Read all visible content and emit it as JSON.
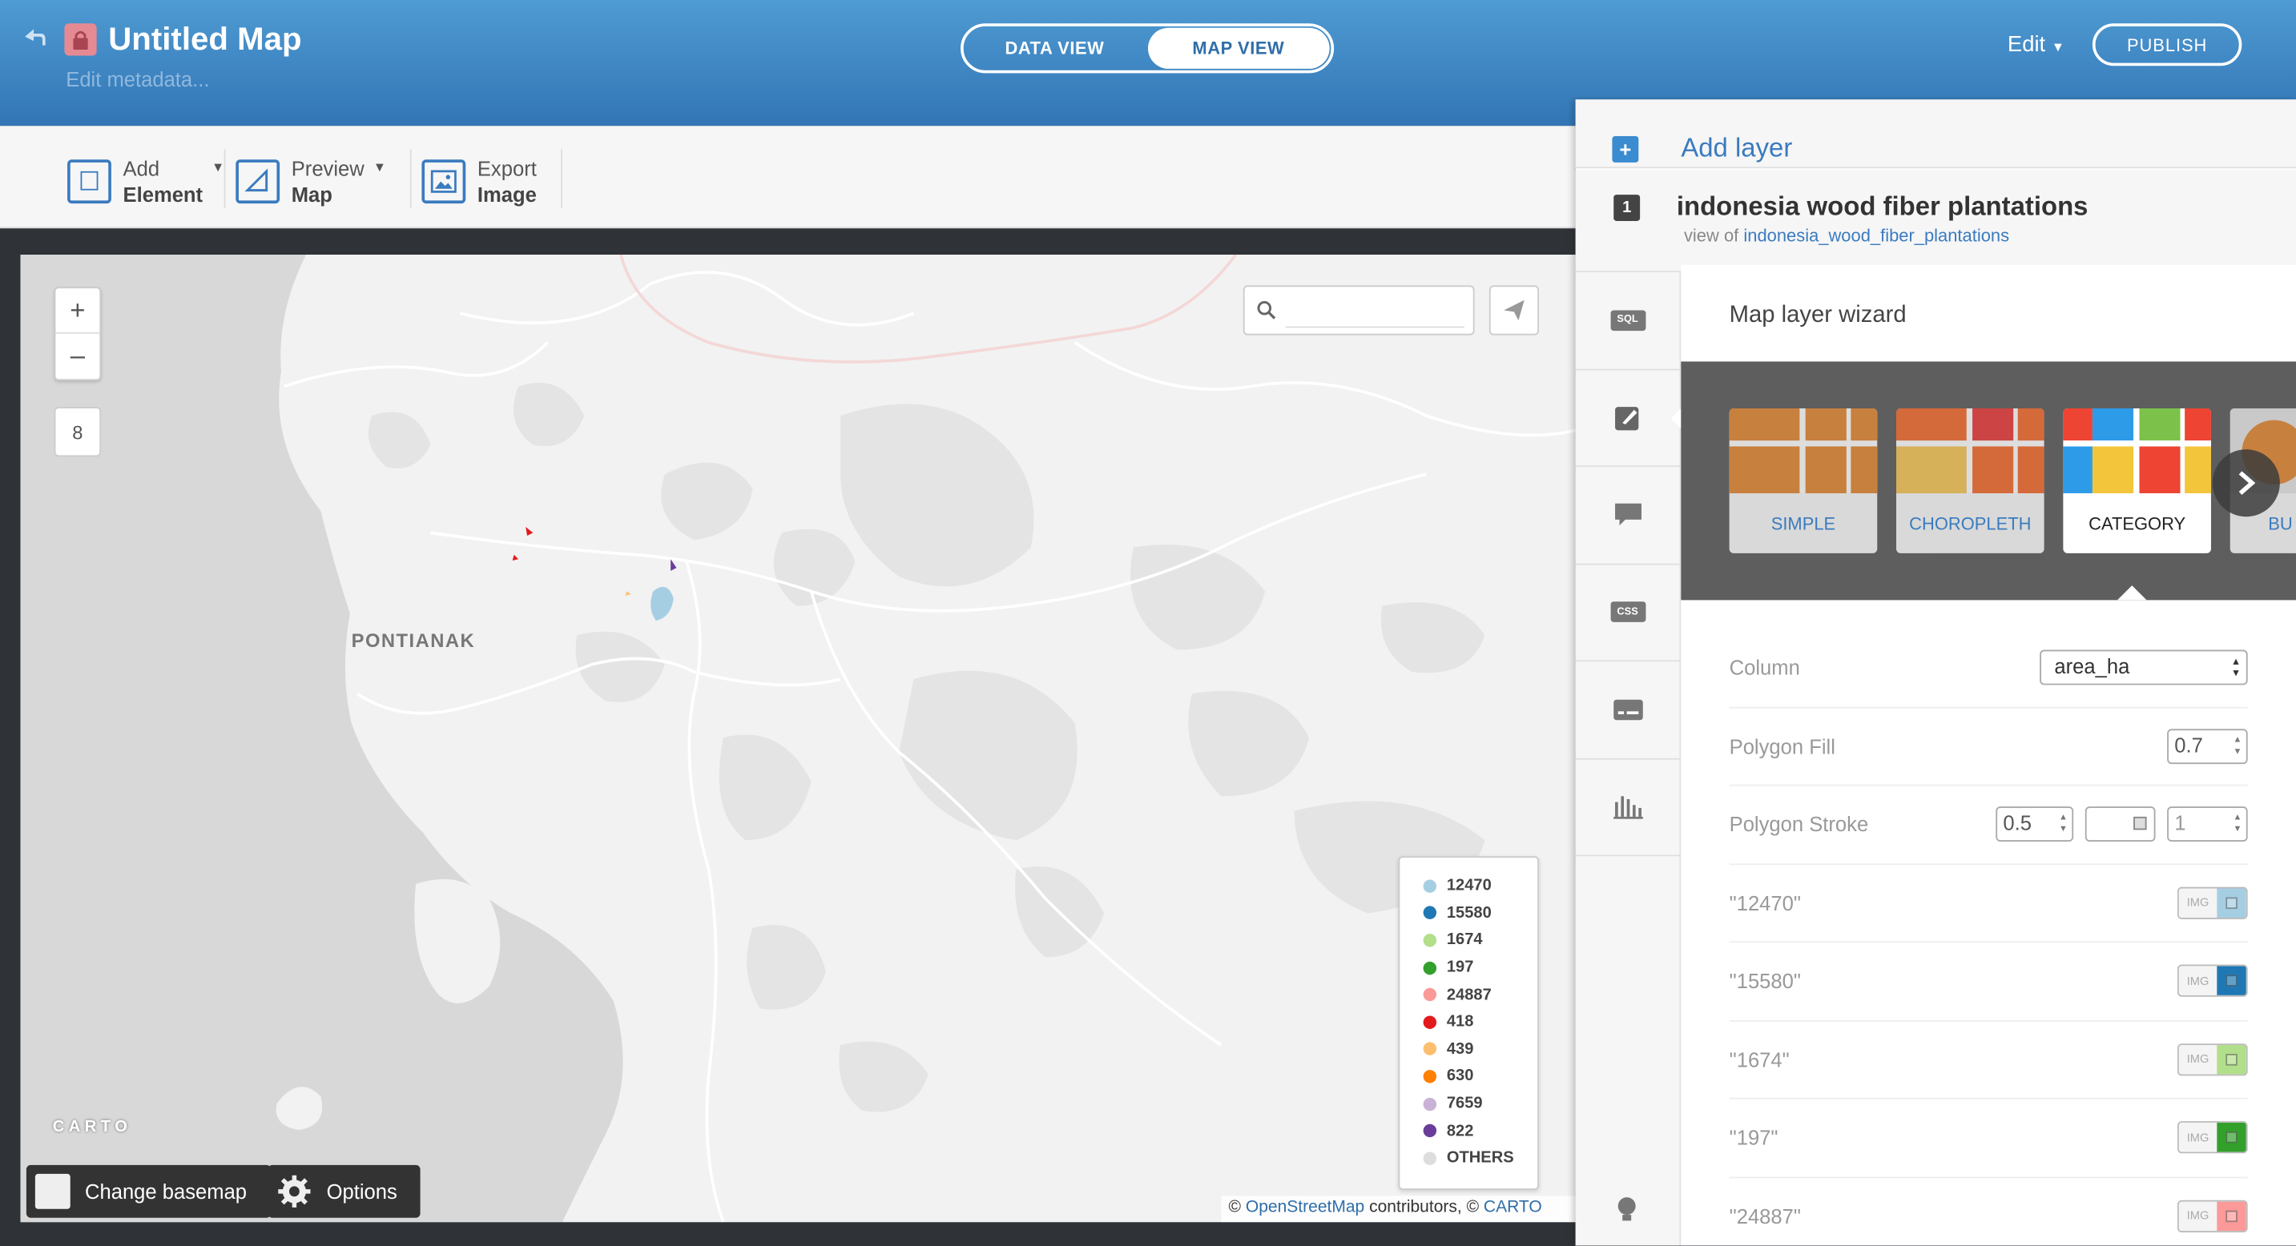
{
  "header": {
    "title": "Untitled Map",
    "metadata_link": "Edit metadata...",
    "data_view": "DATA VIEW",
    "map_view": "MAP VIEW",
    "edit_menu": "Edit",
    "publish": "PUBLISH"
  },
  "toolbar": {
    "add_element": {
      "line1": "Add",
      "line2": "Element"
    },
    "preview_map": {
      "line1": "Preview",
      "line2": "Map"
    },
    "export_image": {
      "line1": "Export",
      "line2": "Image"
    }
  },
  "map": {
    "zoom_in": "+",
    "zoom_out": "–",
    "zoom_level": "8",
    "search_placeholder": "",
    "city_label": "PONTIANAK",
    "logo": "CARTO",
    "attribution": {
      "prefix": "© ",
      "osm": "OpenStreetMap",
      "middle": " contributors, © ",
      "carto": "CARTO"
    },
    "change_basemap": "Change basemap",
    "options": "Options"
  },
  "legend": [
    {
      "label": "12470",
      "color": "#a6cee3"
    },
    {
      "label": "15580",
      "color": "#1f78b4"
    },
    {
      "label": "1674",
      "color": "#b2df8a"
    },
    {
      "label": "197",
      "color": "#33a02c"
    },
    {
      "label": "24887",
      "color": "#fb9a99"
    },
    {
      "label": "418",
      "color": "#e31a1c"
    },
    {
      "label": "439",
      "color": "#fdbf6f"
    },
    {
      "label": "630",
      "color": "#ff7f00"
    },
    {
      "label": "7659",
      "color": "#cab2d6"
    },
    {
      "label": "822",
      "color": "#6a3d9a"
    },
    {
      "label": "OTHERS",
      "color": "#dddddd"
    }
  ],
  "panel": {
    "add_layer": "Add layer",
    "layer_number": "1",
    "layer_name": "indonesia wood fiber plantations",
    "view_of_prefix": "view of",
    "view_of_table": "indonesia_wood_fiber_plantations",
    "side_tabs": [
      {
        "name": "sql",
        "text": "SQL"
      },
      {
        "name": "wizard",
        "text": ""
      },
      {
        "name": "infowindow",
        "text": ""
      },
      {
        "name": "css",
        "text": "CSS"
      },
      {
        "name": "legends",
        "text": ""
      },
      {
        "name": "filters",
        "text": ""
      }
    ]
  },
  "wizard": {
    "title": "Map layer wizard",
    "types": [
      "SIMPLE",
      "CHOROPLETH",
      "CATEGORY",
      "BU"
    ],
    "selected": "CATEGORY",
    "column_label": "Column",
    "column_value": "area_ha",
    "polygon_fill_label": "Polygon Fill",
    "polygon_fill_value": "0.7",
    "polygon_stroke_label": "Polygon Stroke",
    "polygon_stroke_width": "0.5",
    "polygon_stroke_opacity": "1",
    "img_label": "IMG",
    "categories": [
      {
        "label": "\"12470\"",
        "color": "#a6cee3"
      },
      {
        "label": "\"15580\"",
        "color": "#1f78b4"
      },
      {
        "label": "\"1674\"",
        "color": "#b2df8a"
      },
      {
        "label": "\"197\"",
        "color": "#33a02c"
      },
      {
        "label": "\"24887\"",
        "color": "#fb9a99"
      }
    ]
  }
}
